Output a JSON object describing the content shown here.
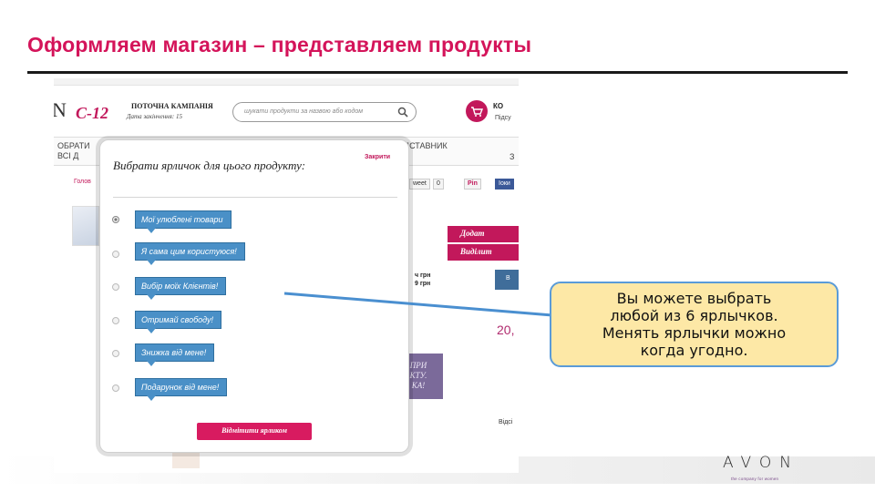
{
  "slide": {
    "title": "Оформляем магазин – представляем продукты"
  },
  "site": {
    "logo_fragment": "N",
    "campaign_code": "С-12",
    "campaign_title": "ПОТОЧНА КАМПАНІЯ",
    "campaign_subtitle": "Дата закінчення: 15",
    "search_placeholder": "шукати продукти за назвою або кодом",
    "cart_label": "КО",
    "cart_sub": "Підсу",
    "nav_left": "ОБРАТИ\nВСІ Д",
    "nav_right": "ЕДСТАВНИК",
    "nav_far": "З",
    "breadcrumb": "Голов",
    "share_tweet": "weet",
    "share_tweet_count": "0",
    "share_pin": "Pin",
    "share_fb": "Іоки",
    "btn_add": "Додат",
    "btn_select": "Виділит",
    "price": "20,",
    "price_small": "ч грн\n9 грн",
    "promo": "ПРИ\nКТУ.\nКА!",
    "details": "Відсі",
    "flag_label": "В"
  },
  "modal": {
    "title": "Вибрати ярличок для цього продукту:",
    "close_label": "Закрити",
    "options": [
      {
        "label": "Мої улюблені товари",
        "selected": true
      },
      {
        "label": "Я сама цим користуюся!",
        "selected": false
      },
      {
        "label": "Вибір моїх Клієнтів!",
        "selected": false
      },
      {
        "label": "Отримай свободу!",
        "selected": false
      },
      {
        "label": "Знижка від мене!",
        "selected": false
      },
      {
        "label": "Подарунок від мене!",
        "selected": false
      }
    ],
    "submit_label": "Відмітити ярликом"
  },
  "callout": {
    "lines": [
      "Вы можете выбрать",
      "любой из 6 ярлычков.",
      "Менять ярлычки можно",
      "когда угодно."
    ]
  },
  "branding": {
    "logo": "AVON",
    "tagline": "the company for women"
  },
  "colors": {
    "title": "#d4145a",
    "accent": "#c2185b",
    "label_blue": "#4a90c7",
    "callout_fill": "#fde8a6",
    "callout_border": "#5a9bd8"
  }
}
